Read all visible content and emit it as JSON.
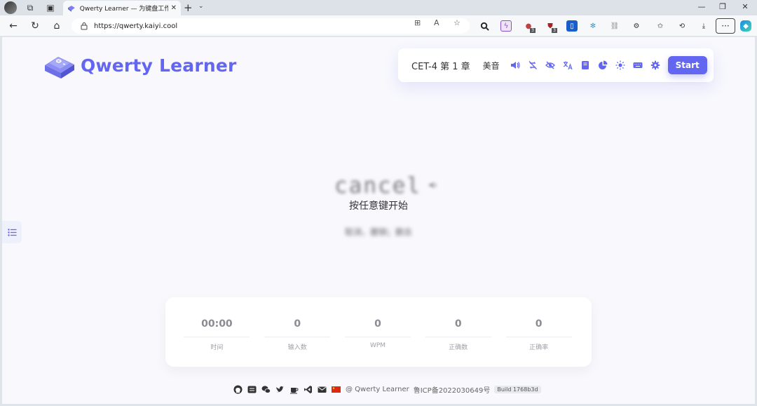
{
  "browser": {
    "tab_title": "Qwerty Learner — 为键盘工作者",
    "url": "https://qwerty.kaiyi.cool",
    "ext_badges": [
      "3",
      "3"
    ]
  },
  "app": {
    "brand": "Qwerty Learner",
    "dictionary": "CET-4 第 1 章",
    "accent": "美音",
    "start_label": "Start"
  },
  "practice": {
    "word": "cancel",
    "hint": "按任意键开始",
    "translation": "取消，撤销；删去"
  },
  "stats": [
    {
      "value": "00:00",
      "label": "时间"
    },
    {
      "value": "0",
      "label": "输入数"
    },
    {
      "value": "0",
      "label": "WPM"
    },
    {
      "value": "0",
      "label": "正确数"
    },
    {
      "value": "0",
      "label": "正确率"
    }
  ],
  "footer": {
    "copyright": "@ Qwerty Learner",
    "icp": "鲁ICP备2022030649号",
    "build": "Build 1768b3d"
  },
  "colors": {
    "accent": "#6366f1",
    "page_bg": "#f8f8fd"
  }
}
